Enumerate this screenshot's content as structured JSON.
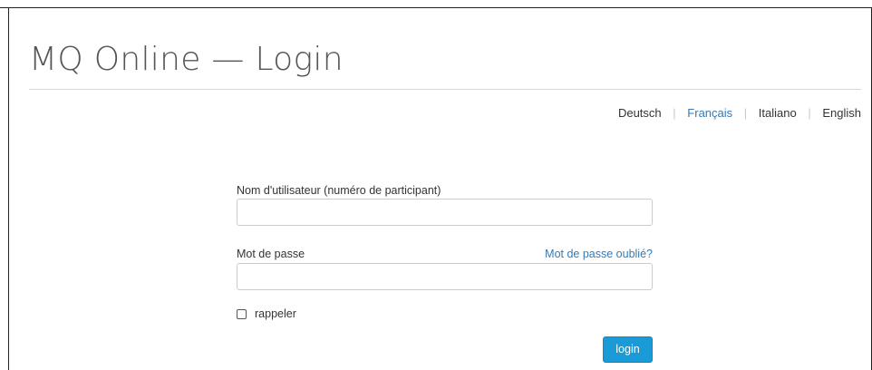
{
  "header": {
    "title": "MQ Online — Login"
  },
  "languages": [
    {
      "label": "Deutsch",
      "active": false
    },
    {
      "label": "Français",
      "active": true
    },
    {
      "label": "Italiano",
      "active": false
    },
    {
      "label": "English",
      "active": false
    }
  ],
  "language_separator": "|",
  "form": {
    "username_label": "Nom d'utilisateur (numéro de participant)",
    "username_value": "",
    "password_label": "Mot de passe",
    "password_value": "",
    "forgot_password_link": "Mot de passe oublié?",
    "remember_label": "rappeler",
    "remember_checked": false,
    "login_button": "login"
  },
  "colors": {
    "link": "#337ab7",
    "button": "#1a9bd7",
    "title": "#555555"
  }
}
